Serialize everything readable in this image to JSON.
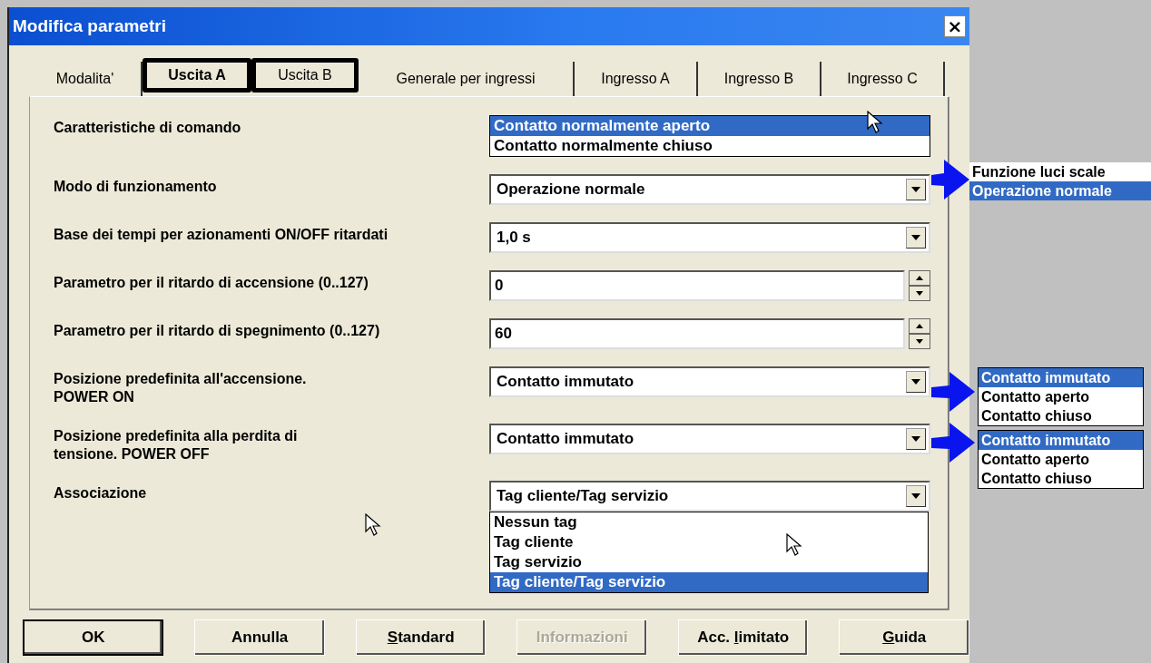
{
  "window": {
    "title": "Modifica parametri",
    "close": "×"
  },
  "tabs": [
    {
      "label": "Modalita'",
      "selected": false,
      "outlined": false
    },
    {
      "label": "Uscita A",
      "selected": true,
      "outlined": true
    },
    {
      "label": "Uscita B",
      "selected": false,
      "outlined": true
    },
    {
      "label": "Generale per ingressi",
      "selected": false,
      "outlined": false
    },
    {
      "label": "Ingresso A",
      "selected": false,
      "outlined": false
    },
    {
      "label": "Ingresso B",
      "selected": false,
      "outlined": false
    },
    {
      "label": "Ingresso C",
      "selected": false,
      "outlined": false
    }
  ],
  "parameters": [
    {
      "label": "Caratteristiche di comando",
      "kind": "list",
      "options": [
        {
          "label": "Contatto normalmente aperto",
          "selected": true
        },
        {
          "label": "Contatto normalmente chiuso",
          "selected": false
        }
      ]
    },
    {
      "label": "Modo di funzionamento",
      "kind": "dropdown",
      "value": "Operazione normale"
    },
    {
      "label": "Base dei tempi per azionamenti ON/OFF ritardati",
      "kind": "dropdown",
      "value": "1,0 s"
    },
    {
      "label": "Parametro per il ritardo di accensione (0..127)",
      "kind": "spin",
      "value": "0"
    },
    {
      "label": "Parametro per il ritardo di spegnimento (0..127)",
      "kind": "spin",
      "value": "60"
    },
    {
      "label": "Posizione predefinita all'accensione.\nPOWER ON",
      "kind": "dropdown",
      "value": "Contatto immutato"
    },
    {
      "label": "Posizione predefinita alla perdita di\ntensione. POWER OFF",
      "kind": "dropdown",
      "value": "Contatto immutato"
    },
    {
      "label": "Associazione",
      "kind": "dropdown",
      "value": "Tag cliente/Tag servizio",
      "options": [
        {
          "label": "Nessun tag",
          "selected": false
        },
        {
          "label": "Tag cliente",
          "selected": false
        },
        {
          "label": "Tag servizio",
          "selected": false
        },
        {
          "label": "Tag cliente/Tag servizio",
          "selected": true
        }
      ]
    }
  ],
  "buttons": [
    {
      "pre": "OK",
      "disabled": false,
      "default": true
    },
    {
      "pre": "Annulla",
      "disabled": false,
      "default": false
    },
    {
      "key": "S",
      "post": "tandard",
      "disabled": false,
      "default": false
    },
    {
      "pre": "Informazioni",
      "disabled": true,
      "default": false
    },
    {
      "pre": "Acc. ",
      "key": "l",
      "post": "imitato",
      "disabled": false,
      "default": false
    },
    {
      "key": "G",
      "post": "uida",
      "disabled": false,
      "default": false
    }
  ],
  "callouts": [
    {
      "options": [
        {
          "label": "Funzione luci scale",
          "selected": false
        },
        {
          "label": "Operazione normale",
          "selected": true
        }
      ]
    },
    {
      "options": [
        {
          "label": "Contatto immutato",
          "selected": true
        },
        {
          "label": "Contatto aperto",
          "selected": false
        },
        {
          "label": "Contatto chiuso",
          "selected": false
        }
      ]
    },
    {
      "options": [
        {
          "label": "Contatto immutato",
          "selected": true
        },
        {
          "label": "Contatto aperto",
          "selected": false
        },
        {
          "label": "Contatto chiuso",
          "selected": false
        }
      ]
    }
  ]
}
